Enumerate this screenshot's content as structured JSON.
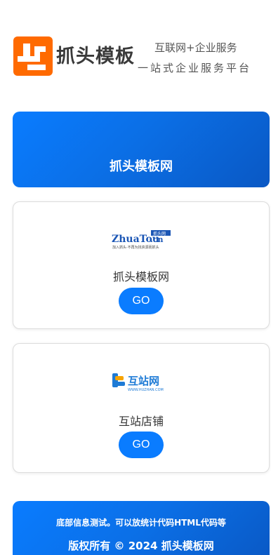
{
  "header": {
    "logo_text": "抓头模板",
    "slogan_line1": "互联网+企业服务",
    "slogan_line2": "一站式企业服务平台"
  },
  "banner": {
    "title": "抓头模板网"
  },
  "cards": [
    {
      "logo_word": "ZhuaTou",
      "logo_suffix": ".cn",
      "logo_badge": "抓头网",
      "logo_tagline": "加入抓头·不再为找资源而抓头",
      "name": "抓头模板网",
      "button": "GO"
    },
    {
      "logo_word": "互站网",
      "logo_tagline": "WWW.HUZHAN.COM",
      "name": "互站店铺",
      "button": "GO"
    }
  ],
  "footer": {
    "note": "底部信息测试。可以放统计代码HTML代码等",
    "copyright": "版权所有 © 2024 抓头模板网"
  },
  "colors": {
    "brand_orange": "#ff6a00",
    "accent_blue": "#0a7cff"
  }
}
